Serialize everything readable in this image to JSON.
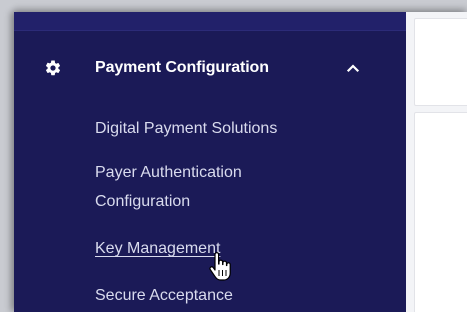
{
  "sidebar": {
    "section": {
      "label": "Payment Configuration",
      "icon": "gear-icon",
      "expand_icon": "chevron-up-icon",
      "expanded": true
    },
    "items": [
      {
        "label": "Digital Payment Solutions"
      },
      {
        "label": "Payer Authentication Configuration"
      },
      {
        "label": "Key Management",
        "hovered": true
      },
      {
        "label": "Secure Acceptance"
      }
    ]
  },
  "colors": {
    "sidebar_bg": "#1b1a57",
    "text_primary": "#ffffff",
    "text_secondary": "#d9dbee",
    "content_bg": "#f3f4f7"
  }
}
